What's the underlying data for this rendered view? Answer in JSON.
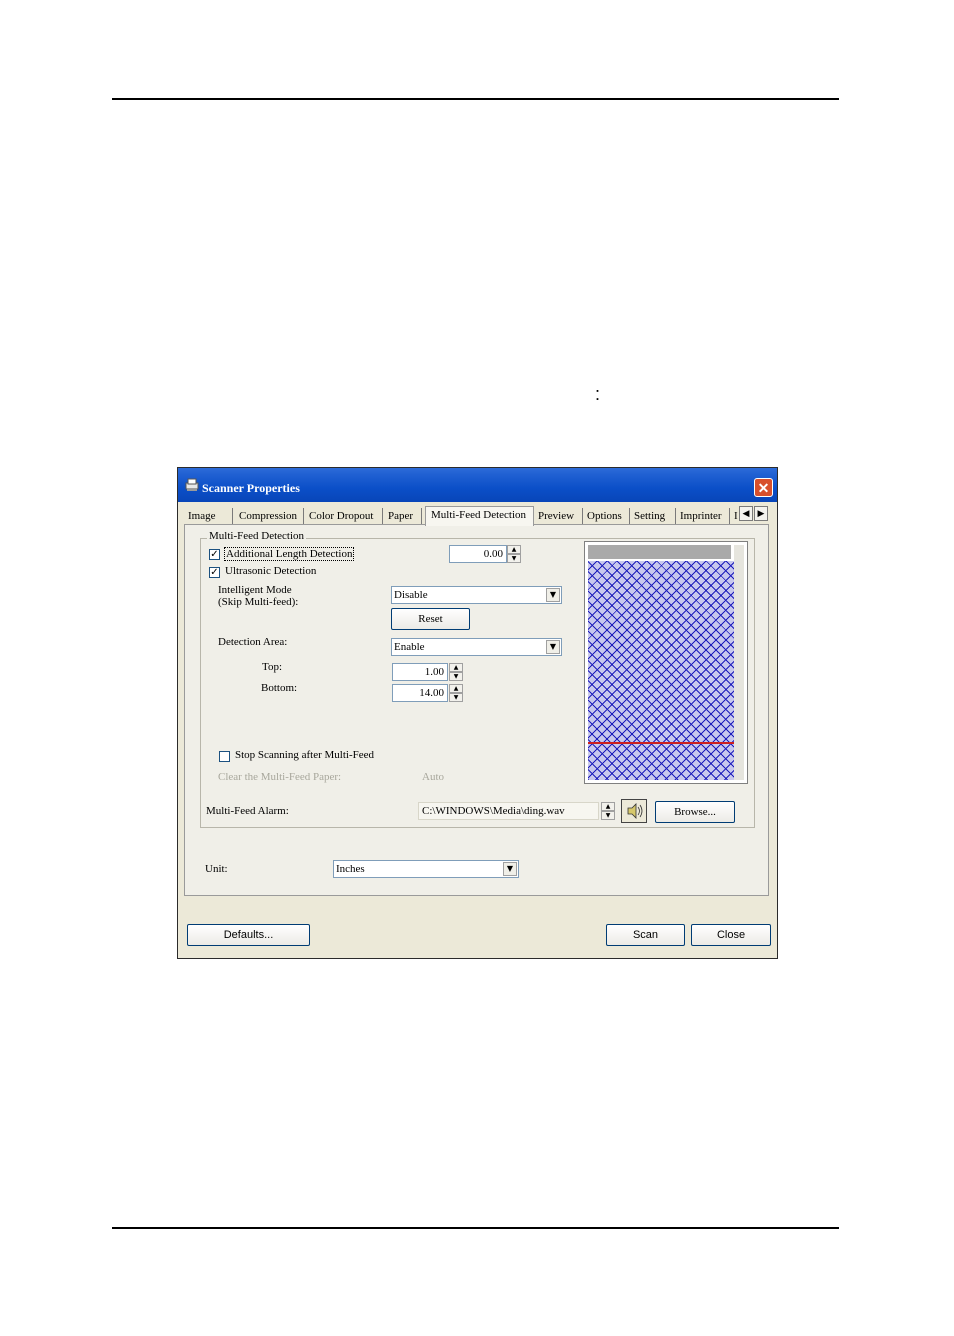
{
  "page": {
    "colon": ":"
  },
  "window": {
    "title": "Scanner Properties",
    "close_glyph": "✕",
    "tabs": [
      "Image",
      "Compression",
      "Color Dropout",
      "Paper",
      "Multi-Feed Detection",
      "Preview",
      "Options",
      "Setting",
      "Imprinter",
      "I"
    ],
    "active_tab": "Multi-Feed Detection",
    "tab_scroll": {
      "left": "◀",
      "right": "▶"
    }
  },
  "group": {
    "title": "Multi-Feed Detection",
    "length_detection": {
      "label": "Additional Length Detection",
      "checked": true,
      "check_glyph": "✓",
      "value": "0.00"
    },
    "ultrasonic": {
      "label": "Ultrasonic Detection",
      "checked": true,
      "check_glyph": "✓"
    },
    "intelligent_mode": {
      "label_line1": "Intelligent Mode",
      "label_line2": "(Skip Multi-feed):",
      "value": "Disable",
      "reset_label": "Reset"
    },
    "detection_area": {
      "label": "Detection Area:",
      "value": "Enable",
      "top_label": "Top:",
      "top_value": "1.00",
      "bottom_label": "Bottom:",
      "bottom_value": "14.00"
    },
    "stop_scanning": {
      "label": "Stop Scanning after Multi-Feed",
      "checked": false
    },
    "clear_paper": {
      "label": "Clear the Multi-Feed Paper:",
      "value": "Auto"
    },
    "alarm": {
      "label": "Multi-Feed Alarm:",
      "value": "C:\\WINDOWS\\Media\\ding.wav",
      "browse_label": "Browse..."
    }
  },
  "unit": {
    "label": "Unit:",
    "value": "Inches"
  },
  "footer": {
    "defaults_label": "Defaults...",
    "scan_label": "Scan",
    "close_label": "Close"
  },
  "icons": {
    "arrow_down": "▼",
    "spin_up": "▲",
    "spin_down": "▼"
  },
  "colors": {
    "titlebar": "#0b4fc8",
    "hatch": "#1d1dbb",
    "marker_line": "#cc1f1f"
  }
}
